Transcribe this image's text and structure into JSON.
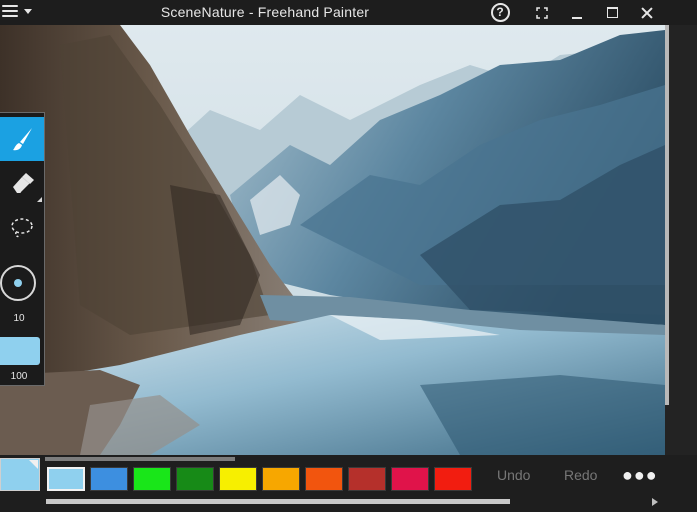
{
  "window": {
    "title": "SceneNature - Freehand Painter",
    "help_icon": "question-circle-icon",
    "menu_icon": "hamburger-menu-icon"
  },
  "toolbox": {
    "tools": [
      {
        "name": "brush",
        "icon": "paintbrush-icon",
        "active": true
      },
      {
        "name": "eraser",
        "icon": "eraser-icon",
        "active": false
      },
      {
        "name": "lasso",
        "icon": "lasso-select-icon",
        "active": false
      }
    ],
    "brush_size": "10",
    "opacity": "100"
  },
  "palette": {
    "current_color": "#8fd0ee",
    "swatches": [
      "#8fd0ee",
      "#3d8fe0",
      "#19e619",
      "#178a17",
      "#f7ef00",
      "#f7a700",
      "#f2550e",
      "#b5302b",
      "#e0134a",
      "#f21d10"
    ],
    "selected_index": 0
  },
  "actions": {
    "undo": "Undo",
    "redo": "Redo",
    "more": "●●●"
  }
}
